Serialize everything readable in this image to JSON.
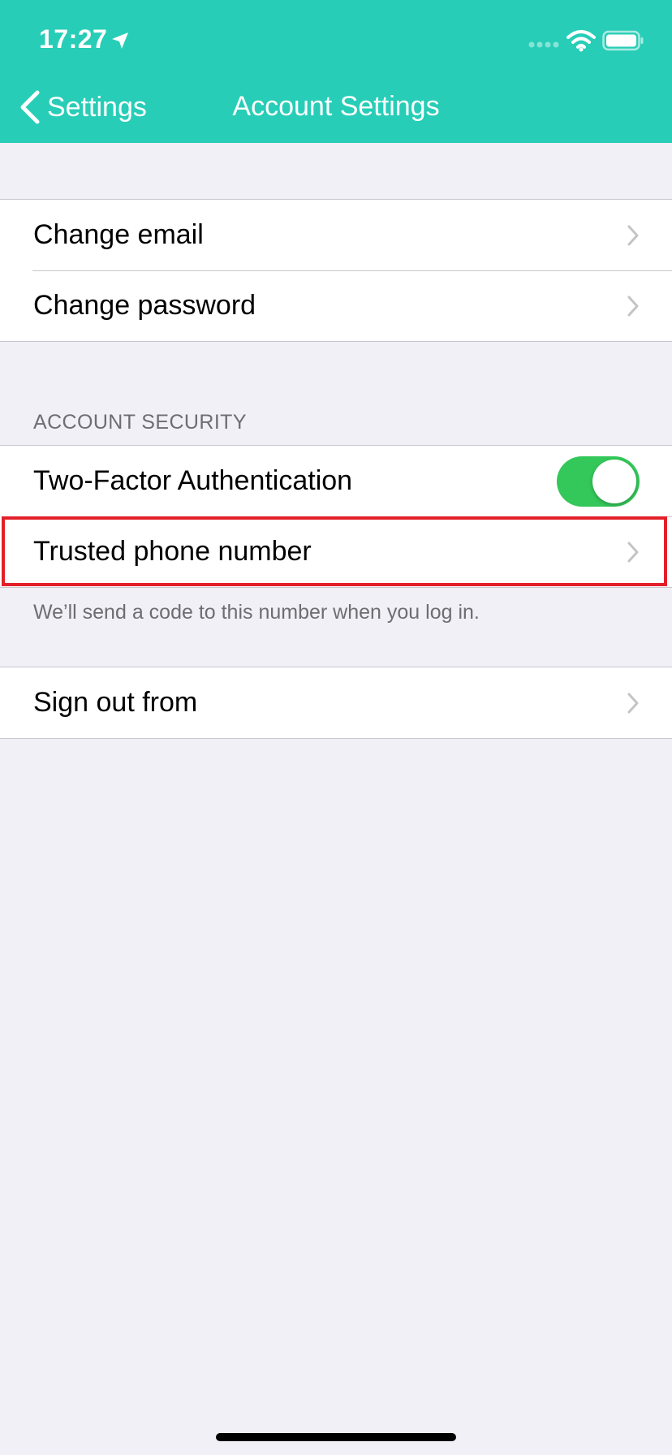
{
  "status_bar": {
    "time": "17:27"
  },
  "nav": {
    "back_label": "Settings",
    "title": "Account Settings"
  },
  "group1": {
    "items": [
      {
        "label": "Change email"
      },
      {
        "label": "Change password"
      }
    ]
  },
  "security": {
    "header": "ACCOUNT SECURITY",
    "two_factor_label": "Two-Factor Authentication",
    "two_factor_enabled": true,
    "trusted_phone_label": "Trusted phone number",
    "footer": "We’ll send a code to this number when you log in."
  },
  "group3": {
    "sign_out_label": "Sign out from"
  },
  "colors": {
    "header_bg": "#27CDB7",
    "toggle_on": "#34C759",
    "highlight": "#E3202A",
    "page_bg": "#F0F0F6"
  },
  "icons": {
    "back": "chevron-left-icon",
    "row_disclosure": "chevron-right-icon",
    "location": "location-arrow-icon",
    "wifi": "wifi-icon",
    "battery": "battery-icon"
  }
}
